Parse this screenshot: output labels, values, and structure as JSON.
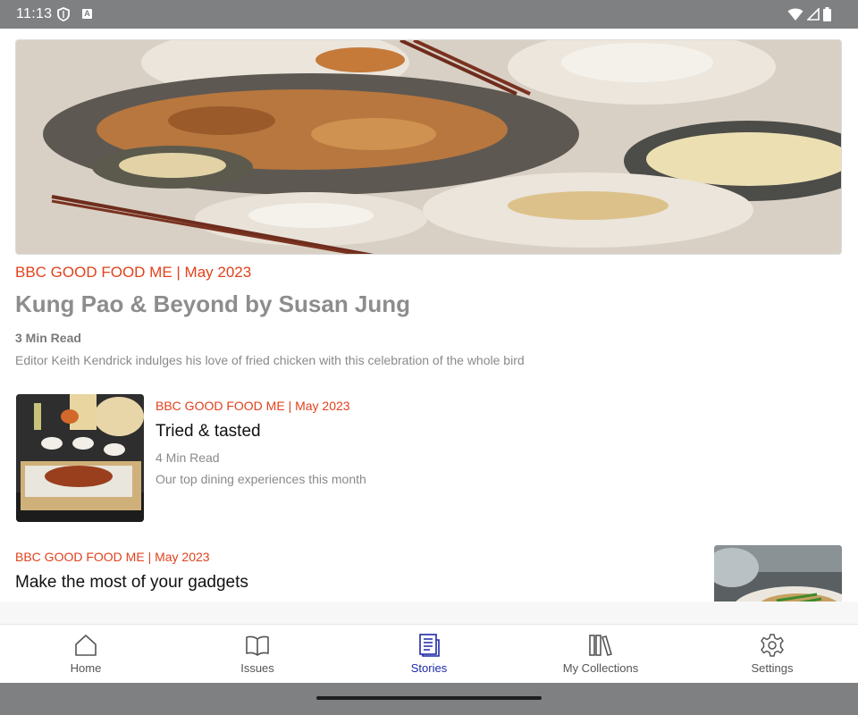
{
  "status_bar": {
    "time": "11:13",
    "keyboard_badge": "A",
    "icons": [
      "shield-icon",
      "keyboard-icon",
      "wifi-icon",
      "signal-icon",
      "battery-icon"
    ]
  },
  "hero": {
    "image": "food-platter-photo",
    "meta": "BBC GOOD FOOD ME | May 2023",
    "title": "Kung Pao & Beyond by Susan Jung",
    "read_time": "3 Min Read",
    "description": "Editor Keith Kendrick indulges his love of fried chicken with this celebration of the whole bird"
  },
  "stories": [
    {
      "image": "dim-sum-photo",
      "meta": "BBC GOOD FOOD ME | May 2023",
      "title": "Tried & tasted",
      "read_time": "4 Min Read",
      "description": "Our top dining experiences this month"
    },
    {
      "image": "gadget-dish-photo",
      "meta": "BBC GOOD FOOD ME | May 2023",
      "title": "Make the most of your gadgets"
    }
  ],
  "bottom_nav": {
    "items": [
      {
        "label": "Home",
        "icon": "home-icon"
      },
      {
        "label": "Issues",
        "icon": "book-icon"
      },
      {
        "label": "Stories",
        "icon": "stories-icon"
      },
      {
        "label": "My Collections",
        "icon": "collections-icon"
      },
      {
        "label": "Settings",
        "icon": "gear-icon"
      }
    ],
    "active": "Stories",
    "active_color": "#1f2aa8"
  },
  "colors": {
    "accent": "#e2411b",
    "system_bar": "#7f8082"
  }
}
